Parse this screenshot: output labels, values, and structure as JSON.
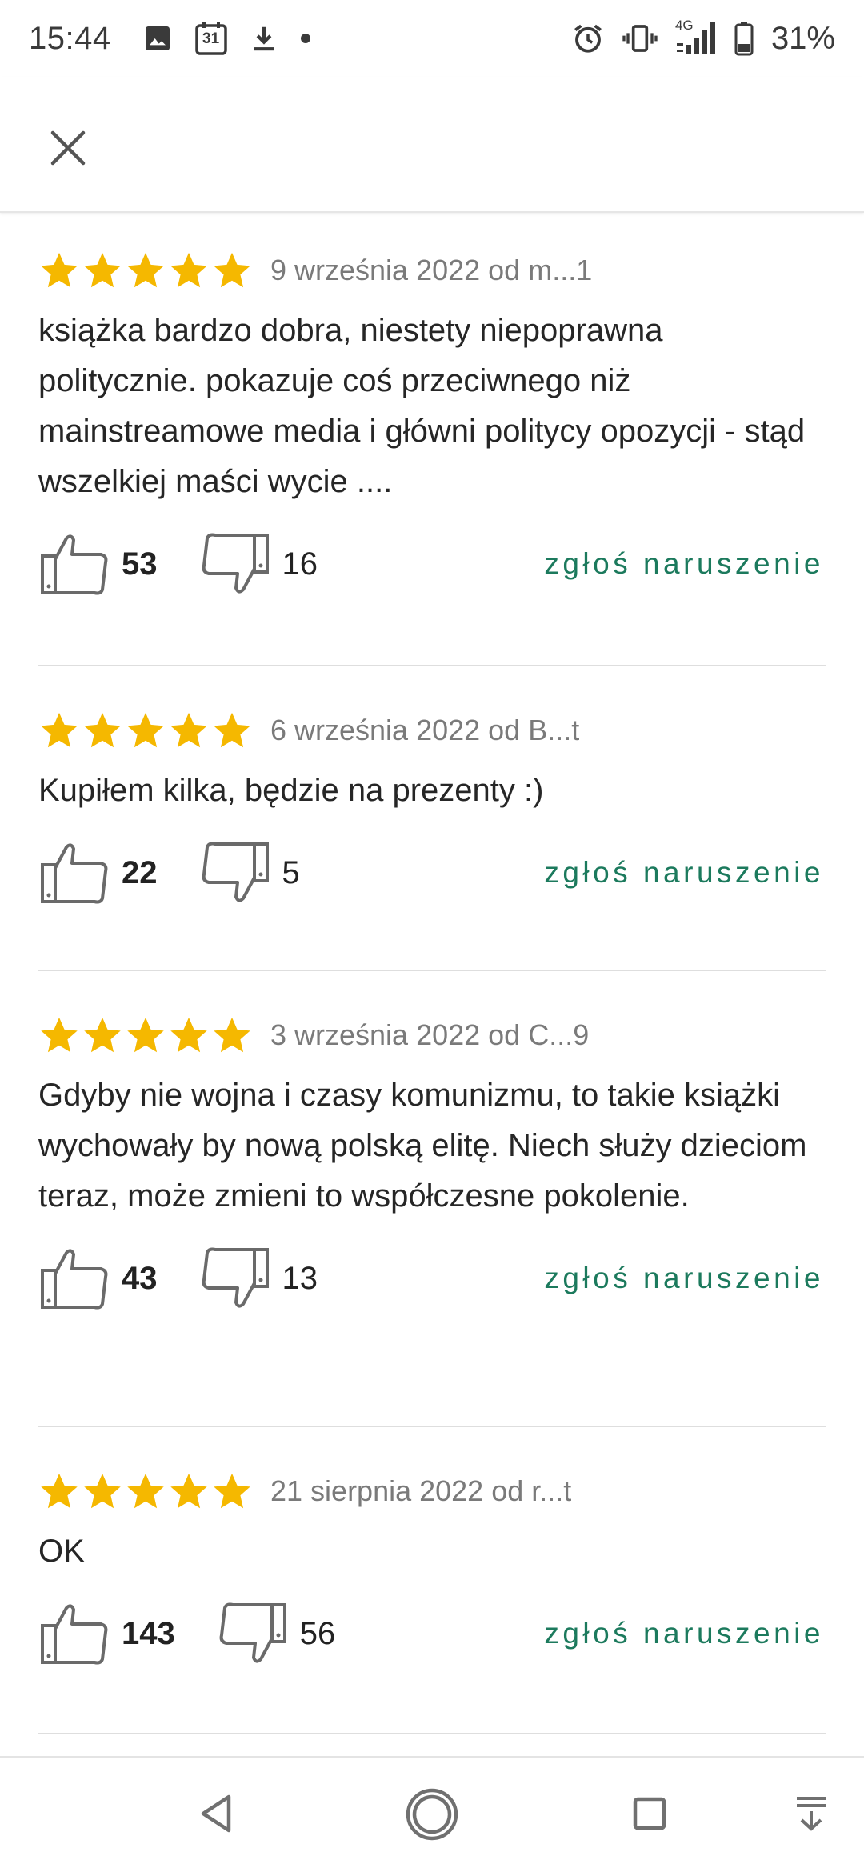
{
  "status_bar": {
    "time": "15:44",
    "calendar_day": "31",
    "network": "4G",
    "battery": "31%",
    "left_icons": [
      "image-icon",
      "calendar-icon",
      "download-icon",
      "dot-icon"
    ],
    "right_icons": [
      "alarm-icon",
      "vibrate-icon",
      "signal-icon",
      "battery-icon"
    ]
  },
  "app_bar": {
    "close_icon": "close-icon"
  },
  "reviews": [
    {
      "rating": 5,
      "meta": "9 września 2022 od m...1",
      "text": "książka bardzo dobra, niestety niepoprawna politycznie. pokazuje coś przeciwnego niż mainstreamowe media i główni politycy opozycji - stąd wszelkiej maści wycie ....",
      "likes": "53",
      "dislikes": "16",
      "report": "zgłoś naruszenie"
    },
    {
      "rating": 5,
      "meta": "6 września 2022 od B...t",
      "text": "Kupiłem kilka, będzie na prezenty :)",
      "likes": "22",
      "dislikes": "5",
      "report": "zgłoś naruszenie"
    },
    {
      "rating": 5,
      "meta": "3 września 2022 od C...9",
      "text": "Gdyby nie wojna i czasy komunizmu, to takie książki wychowały by nową polską elitę. Niech służy dzieciom teraz, może zmieni to współczesne pokolenie.",
      "likes": "43",
      "dislikes": "13",
      "report": "zgłoś naruszenie"
    },
    {
      "rating": 5,
      "meta": "21 sierpnia 2022 od r...t",
      "text": "OK",
      "likes": "143",
      "dislikes": "56",
      "report": "zgłoś naruszenie"
    }
  ],
  "nav_bar": {
    "icons": [
      "back-icon",
      "home-icon",
      "recents-icon",
      "notifications-pull-icon"
    ]
  },
  "colors": {
    "star": "#f5b800",
    "report_link": "#1c7a5d",
    "meta_text": "#7a7a7a"
  }
}
